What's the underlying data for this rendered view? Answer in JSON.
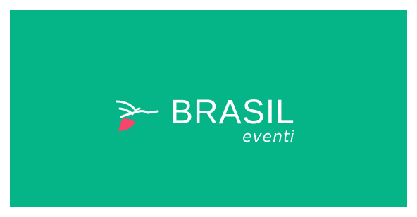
{
  "brand": {
    "name": "BRASIL",
    "tagline": "eventi",
    "background_color": "#05b487",
    "text_color": "#ffffff",
    "accent_color": "#f4476b",
    "icon": "hummingbird-icon"
  }
}
